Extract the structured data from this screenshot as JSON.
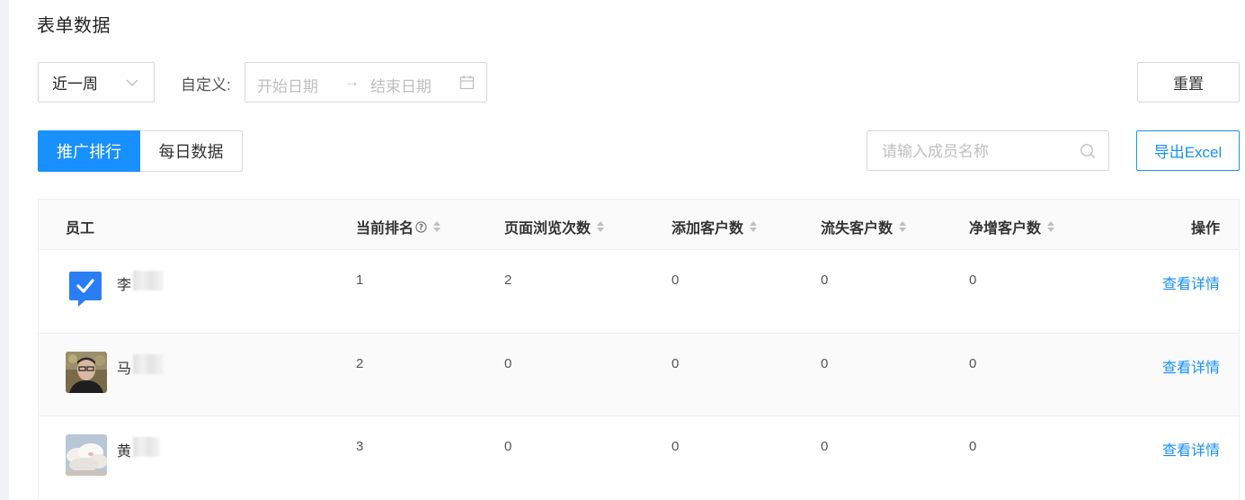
{
  "section_title": "表单数据",
  "filters": {
    "period": "近一周",
    "custom_label": "自定义:",
    "start_placeholder": "开始日期",
    "end_placeholder": "结束日期",
    "range_arrow": "→",
    "reset_label": "重置"
  },
  "tabs": [
    {
      "label": "推广排行",
      "active": true
    },
    {
      "label": "每日数据",
      "active": false
    }
  ],
  "search": {
    "placeholder": "请输入成员名称",
    "value": ""
  },
  "export_label": "导出Excel",
  "table": {
    "columns": [
      "员工",
      "当前排名",
      "页面浏览次数",
      "添加客户数",
      "流失客户数",
      "净增客户数",
      "操作"
    ],
    "rows": [
      {
        "name": "李",
        "rank": "1",
        "views": "2",
        "added": "0",
        "lost": "0",
        "net": "0",
        "action": "查看详情",
        "avatar": "check-badge"
      },
      {
        "name": "马",
        "rank": "2",
        "views": "0",
        "added": "0",
        "lost": "0",
        "net": "0",
        "action": "查看详情",
        "avatar": "photo-person"
      },
      {
        "name": "黄",
        "rank": "3",
        "views": "0",
        "added": "0",
        "lost": "0",
        "net": "0",
        "action": "查看详情",
        "avatar": "photo-clouds"
      }
    ]
  },
  "colors": {
    "primary": "#1890ff",
    "border": "#d9d9d9",
    "header_bg": "#fafafa"
  }
}
